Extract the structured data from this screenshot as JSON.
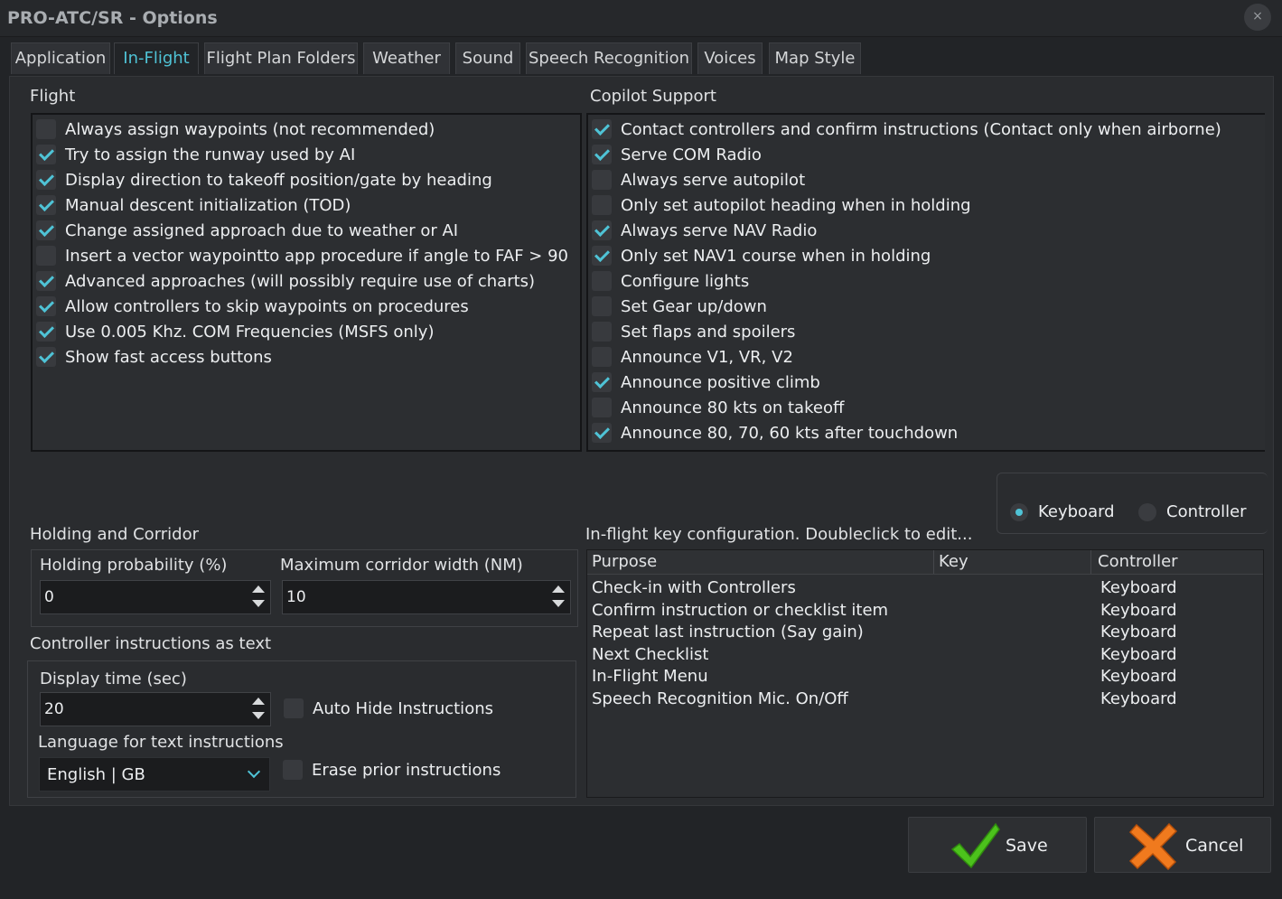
{
  "window": {
    "title": "PRO-ATC/SR - Options",
    "close_glyph": "×"
  },
  "tabs": [
    {
      "label": "Application"
    },
    {
      "label": "In-Flight",
      "active": true
    },
    {
      "label": "Flight Plan Folders"
    },
    {
      "label": "Weather"
    },
    {
      "label": "Sound"
    },
    {
      "label": "Speech Recognition"
    },
    {
      "label": "Voices"
    },
    {
      "label": "Map Style"
    }
  ],
  "flight": {
    "title": "Flight",
    "items": [
      {
        "label": "Always assign waypoints (not recommended)",
        "checked": false
      },
      {
        "label": "Try to assign the runway used by AI",
        "checked": true
      },
      {
        "label": "Display direction to takeoff position/gate by heading",
        "checked": true
      },
      {
        "label": "Manual descent initialization (TOD)",
        "checked": true
      },
      {
        "label": "Change assigned approach due to weather or AI",
        "checked": true
      },
      {
        "label": "Insert a vector waypointto app procedure if angle to FAF > 90",
        "checked": false
      },
      {
        "label": "Advanced approaches (will possibly require use of charts)",
        "checked": true
      },
      {
        "label": "Allow controllers to skip waypoints on procedures",
        "checked": true
      },
      {
        "label": "Use 0.005 Khz. COM Frequencies (MSFS only)",
        "checked": true
      },
      {
        "label": "Show fast access buttons",
        "checked": true
      }
    ]
  },
  "copilot": {
    "title": "Copilot Support",
    "items": [
      {
        "label": "Contact controllers and confirm instructions (Contact only when airborne)",
        "checked": true
      },
      {
        "label": "Serve COM Radio",
        "checked": true
      },
      {
        "label": "Always serve autopilot",
        "checked": false
      },
      {
        "label": "Only set autopilot heading when in holding",
        "checked": false
      },
      {
        "label": "Always serve NAV Radio",
        "checked": true
      },
      {
        "label": "Only set NAV1 course when in holding",
        "checked": true
      },
      {
        "label": "Configure lights",
        "checked": false
      },
      {
        "label": "Set Gear up/down",
        "checked": false
      },
      {
        "label": "Set flaps and spoilers",
        "checked": false
      },
      {
        "label": "Announce V1, VR, V2",
        "checked": false
      },
      {
        "label": "Announce positive climb",
        "checked": true
      },
      {
        "label": "Announce 80 kts on takeoff",
        "checked": false
      },
      {
        "label": "Announce 80, 70, 60 kts after touchdown",
        "checked": true
      }
    ]
  },
  "holding": {
    "title": "Holding and Corridor",
    "probability_label": "Holding probability (%)",
    "probability_value": "0",
    "corridor_label": "Maximum corridor width (NM)",
    "corridor_value": "10"
  },
  "controller_text": {
    "title": "Controller instructions as text",
    "display_time_label": "Display time (sec)",
    "display_time_value": "20",
    "auto_hide_label": "Auto Hide Instructions",
    "auto_hide_checked": false,
    "language_label": "Language for text instructions",
    "language_value": "English | GB",
    "erase_label": "Erase prior instructions",
    "erase_checked": false
  },
  "input_mode": {
    "keyboard_label": "Keyboard",
    "controller_label": "Controller",
    "selected": "Keyboard"
  },
  "keyconfig": {
    "title": "In-flight key configuration. Doubleclick to edit...",
    "columns": [
      "Purpose",
      "Key",
      "Controller"
    ],
    "rows": [
      {
        "purpose": "Check-in with Controllers",
        "key": "",
        "controller": "Keyboard"
      },
      {
        "purpose": "Confirm instruction or checklist item",
        "key": "",
        "controller": "Keyboard"
      },
      {
        "purpose": "Repeat last instruction (Say gain)",
        "key": "",
        "controller": "Keyboard"
      },
      {
        "purpose": "Next Checklist",
        "key": "",
        "controller": "Keyboard"
      },
      {
        "purpose": "In-Flight Menu",
        "key": "",
        "controller": "Keyboard"
      },
      {
        "purpose": "Speech Recognition Mic. On/Off",
        "key": "",
        "controller": "Keyboard"
      }
    ]
  },
  "buttons": {
    "save": "Save",
    "cancel": "Cancel"
  },
  "colors": {
    "accent": "#4fc3d6",
    "save_icon": "#4cc21c",
    "cancel_icon": "#f07a1e"
  },
  "icons": {
    "save": "checkmark-icon",
    "cancel": "x-mark-icon"
  }
}
